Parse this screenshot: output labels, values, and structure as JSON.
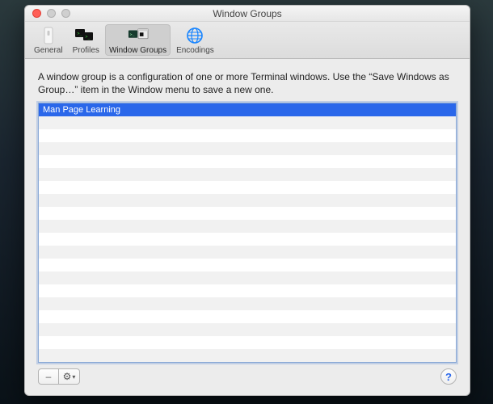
{
  "window": {
    "title": "Window Groups"
  },
  "toolbar": {
    "items": [
      {
        "label": "General"
      },
      {
        "label": "Profiles"
      },
      {
        "label": "Window Groups"
      },
      {
        "label": "Encodings"
      }
    ]
  },
  "main": {
    "description": "A window group is a configuration of one or more Terminal windows. Use the “Save Windows as Group…” item in the Window menu to save a new one.",
    "groups": [
      {
        "name": "Man Page Learning",
        "selected": true
      }
    ]
  },
  "footer": {
    "remove_label": "–",
    "action_label": "⚙",
    "help_label": "?"
  }
}
